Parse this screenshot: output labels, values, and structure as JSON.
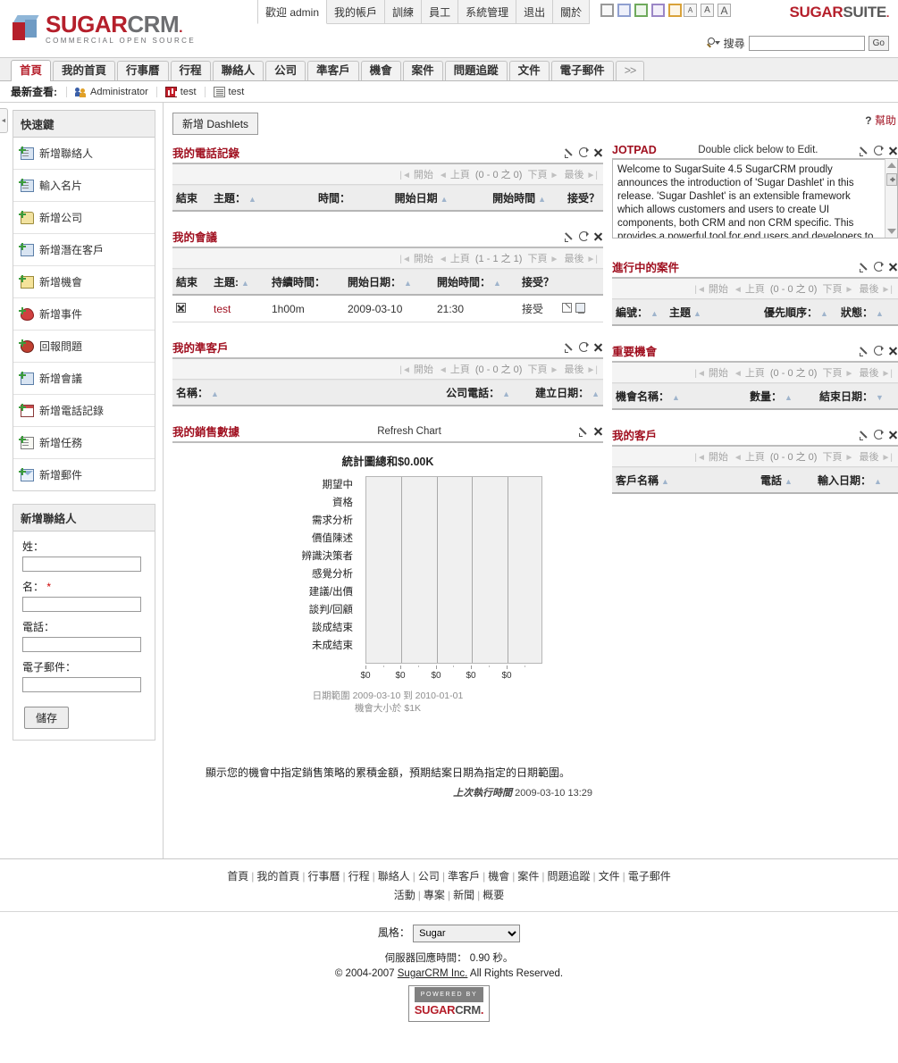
{
  "header": {
    "logo": {
      "brand_red": "SUGAR",
      "brand_gray": "CRM",
      "dot": ".",
      "tagline": "COMMERCIAL OPEN SOURCE"
    },
    "topnav": [
      {
        "label": "歡迎 admin",
        "name": "welcome-admin"
      },
      {
        "label": "我的帳戶",
        "name": "my-account"
      },
      {
        "label": "訓練",
        "name": "training"
      },
      {
        "label": "員工",
        "name": "employees"
      },
      {
        "label": "系統管理",
        "name": "admin"
      },
      {
        "label": "退出",
        "name": "logout"
      },
      {
        "label": "關於",
        "name": "about"
      }
    ],
    "theme_swatches": [
      "#999999",
      "#8f9fd0",
      "#6faa5c",
      "#9b86c6",
      "#d9a23a"
    ],
    "font_sizes": [
      "A",
      "A",
      "A"
    ],
    "suite_logo": {
      "red": "SUGAR",
      "gray": "SUITE",
      "dot": "."
    },
    "search": {
      "label": "搜尋",
      "value": "",
      "placeholder": "",
      "button": "Go",
      "icon": "search-icon"
    }
  },
  "tabs": [
    {
      "label": "首頁",
      "active": true
    },
    {
      "label": "我的首頁",
      "active": false
    },
    {
      "label": "行事曆",
      "active": false
    },
    {
      "label": "行程",
      "active": false
    },
    {
      "label": "聯絡人",
      "active": false
    },
    {
      "label": "公司",
      "active": false
    },
    {
      "label": "準客戶",
      "active": false
    },
    {
      "label": "機會",
      "active": false
    },
    {
      "label": "案件",
      "active": false
    },
    {
      "label": "問題追蹤",
      "active": false
    },
    {
      "label": "文件",
      "active": false
    },
    {
      "label": "電子郵件",
      "active": false
    },
    {
      "label": ">>",
      "active": false
    }
  ],
  "recent": {
    "label": "最新查看:",
    "items": [
      {
        "label": "Administrator",
        "icon": "user-icon"
      },
      {
        "label": "test",
        "icon": "chart-icon"
      },
      {
        "label": "test",
        "icon": "document-icon"
      }
    ]
  },
  "shortcuts": {
    "title": "快速鍵",
    "items": [
      {
        "label": "新增聯絡人",
        "icon": "add-contact-icon"
      },
      {
        "label": "輸入名片",
        "icon": "enter-business-card-icon"
      },
      {
        "label": "新增公司",
        "icon": "add-account-icon"
      },
      {
        "label": "新增潛在客戶",
        "icon": "add-lead-icon"
      },
      {
        "label": "新增機會",
        "icon": "add-opportunity-icon"
      },
      {
        "label": "新增事件",
        "icon": "add-case-icon"
      },
      {
        "label": "回報問題",
        "icon": "report-bug-icon"
      },
      {
        "label": "新增會議",
        "icon": "add-meeting-icon"
      },
      {
        "label": "新增電話記錄",
        "icon": "add-call-icon"
      },
      {
        "label": "新增任務",
        "icon": "add-task-icon"
      },
      {
        "label": "新增郵件",
        "icon": "add-email-icon"
      }
    ]
  },
  "quick_form": {
    "title": "新增聯絡人",
    "fields": [
      {
        "label": "姓：",
        "required": false,
        "value": ""
      },
      {
        "label": "名：",
        "required": true,
        "required_mark": "*",
        "value": ""
      },
      {
        "label": "電話：",
        "required": false,
        "value": ""
      },
      {
        "label": "電子郵件：",
        "required": false,
        "value": ""
      }
    ],
    "save_label": "儲存"
  },
  "dash_toolbar": {
    "add_dashlets": "新增 Dashlets",
    "help_q": "?",
    "help_label": "幫助"
  },
  "pager_labels": {
    "start": "開始",
    "prev": "上頁",
    "next": "下頁",
    "last": "最後"
  },
  "dashlets": {
    "my_calls": {
      "title": "我的電話記錄",
      "count": "(0 - 0 之 0)",
      "headers": [
        "結束",
        "主題：",
        "時間：",
        "開始日期",
        "開始時間",
        "接受？"
      ],
      "rows": []
    },
    "my_meetings": {
      "title": "我的會議",
      "count": "(1 - 1 之 1)",
      "headers": [
        "結束",
        "主題:",
        "持續時間：",
        "開始日期：",
        "開始時間：",
        "接受？"
      ],
      "rows": [
        {
          "close": "x",
          "subject": "test",
          "duration": "1h00m",
          "start_date": "2009-03-10",
          "start_time": "21:30",
          "accept": "接受"
        }
      ]
    },
    "my_leads": {
      "title": "我的準客戶",
      "count": "(0 - 0 之 0)",
      "headers": [
        "名稱：",
        "公司電話：",
        "建立日期："
      ],
      "rows": []
    },
    "my_pipeline": {
      "title": "我的銷售數據",
      "refresh_label": "Refresh Chart"
    },
    "jotpad": {
      "title": "JOTPAD",
      "hint": "Double click below to Edit.",
      "text": "Welcome to SugarSuite 4.5\n\nSugarCRM proudly announces the introduction of 'Sugar Dashlet' in this release. 'Sugar Dashlet' is an extensible framework which allows customers and users to create UI components, both CRM and non CRM specific. This provides a powerful tool for end users and developers to customize"
    },
    "open_cases": {
      "title": "進行中的案件",
      "count": "(0 - 0 之 0)",
      "headers": [
        "編號：",
        "主題",
        "優先順序：",
        "狀態："
      ],
      "rows": []
    },
    "top_opportunities": {
      "title": "重要機會",
      "count": "(0 - 0 之 0)",
      "headers": [
        "機會名稱：",
        "數量：",
        "結束日期："
      ],
      "rows": []
    },
    "my_accounts": {
      "title": "我的客戶",
      "count": "(0 - 0 之 0)",
      "headers": [
        "客戶名稱",
        "電話",
        "輸入日期："
      ],
      "rows": []
    }
  },
  "chart_data": {
    "type": "bar",
    "orientation": "horizontal",
    "title": "統計圖總和$0.00K",
    "categories": [
      "期望中",
      "資格",
      "需求分析",
      "價值陳述",
      "辨識決策者",
      "感覺分析",
      "建議/出價",
      "談判/回顧",
      "談成結束",
      "未成結束"
    ],
    "values": [
      0,
      0,
      0,
      0,
      0,
      0,
      0,
      0,
      0,
      0
    ],
    "xlabel": "",
    "ylabel": "",
    "xticklabels": [
      "$0",
      "$0",
      "$0",
      "$0",
      "$0"
    ],
    "xlim": [
      0,
      0
    ],
    "grid": true,
    "legend": false,
    "notes": [
      "日期範圍 2009-03-10 到 2010-01-01",
      "機會大小於 $1K"
    ],
    "description": "顯示您的機會中指定銷售策略的累積金額，預期結案日期為指定的日期範圍。",
    "last_run_label": "上次執行時間",
    "last_run_value": "2009-03-10 13:29"
  },
  "footer": {
    "links_row1": [
      "首頁",
      "我的首頁",
      "行事曆",
      "行程",
      "聯絡人",
      "公司",
      "準客戶",
      "機會",
      "案件",
      "問題追蹤",
      "文件",
      "電子郵件"
    ],
    "links_row2": [
      "活動",
      "專案",
      "新聞",
      "概要"
    ],
    "theme_label": "風格：",
    "theme_value": "Sugar",
    "theme_options": [
      "Sugar"
    ],
    "server_time": "伺服器回應時間： 0.90 秒。",
    "copyright_pre": "© 2004-2007 ",
    "copyright_link": "SugarCRM Inc.",
    "copyright_post": " All Rights Reserved.",
    "powered_top": "POWERED BY",
    "powered_red": "SUGAR",
    "powered_gray": "CRM",
    "powered_dot": "."
  }
}
